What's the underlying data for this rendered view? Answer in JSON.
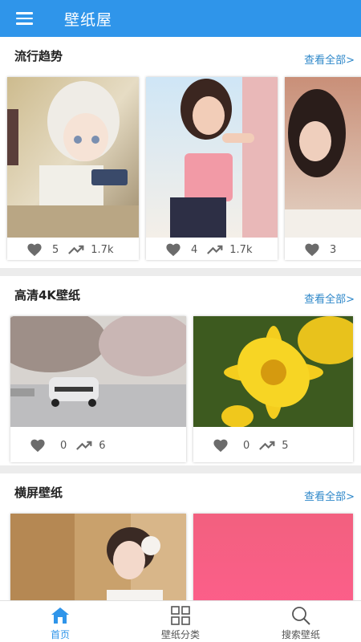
{
  "app": {
    "title": "壁纸屋"
  },
  "colors": {
    "primary": "#2f95ea",
    "link": "#2d87c9"
  },
  "sections": [
    {
      "title": "流行趋势",
      "more": "查看全部>",
      "cards": [
        {
          "likes": "5",
          "trend": "1.7k"
        },
        {
          "likes": "4",
          "trend": "1.7k"
        },
        {
          "likes": "3",
          "trend": ""
        }
      ]
    },
    {
      "title": "高清4K壁纸",
      "more": "查看全部>",
      "cards": [
        {
          "likes": "0",
          "trend": "6"
        },
        {
          "likes": "0",
          "trend": "5"
        }
      ]
    },
    {
      "title": "横屏壁纸",
      "more": "查看全部>",
      "cards": [
        {},
        {}
      ]
    }
  ],
  "tabs": [
    {
      "label": "首页",
      "icon": "home-icon",
      "active": true
    },
    {
      "label": "壁纸分类",
      "icon": "grid-icon",
      "active": false
    },
    {
      "label": "搜索壁纸",
      "icon": "search-icon",
      "active": false
    }
  ]
}
